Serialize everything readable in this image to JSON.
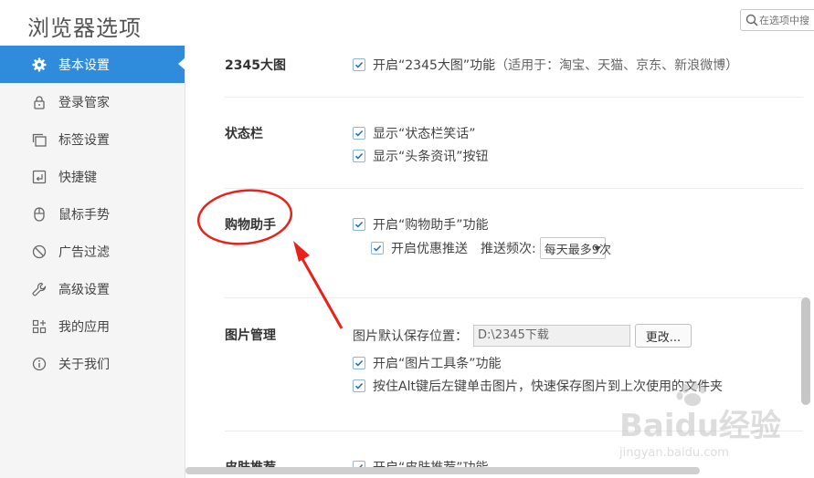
{
  "window": {
    "title": "浏览器选项"
  },
  "search": {
    "placeholder": "在选项中搜"
  },
  "sidebar": {
    "items": [
      {
        "label": "基本设置",
        "icon": "gear-icon",
        "active": true
      },
      {
        "label": "登录管家",
        "icon": "lock-icon"
      },
      {
        "label": "标签设置",
        "icon": "tabs-icon"
      },
      {
        "label": "快捷键",
        "icon": "shortcut-icon"
      },
      {
        "label": "鼠标手势",
        "icon": "mouse-icon"
      },
      {
        "label": "广告过滤",
        "icon": "block-icon"
      },
      {
        "label": "高级设置",
        "icon": "wrench-icon"
      },
      {
        "label": "我的应用",
        "icon": "apps-icon"
      },
      {
        "label": "关于我们",
        "icon": "info-icon"
      }
    ]
  },
  "sections": {
    "s2345": {
      "label": "2345大图",
      "opt1": "开启“2345大图”功能",
      "opt1_note": "（适用于：淘宝、天猫、京东、新浪微博）"
    },
    "statusbar": {
      "label": "状态栏",
      "opt1": "显示“状态栏笑话”",
      "opt2": "显示“头条资讯”按钮"
    },
    "shopping": {
      "label": "购物助手",
      "opt1": "开启“购物助手”功能",
      "opt2": "开启优惠推送",
      "freq_label": "推送频次:",
      "freq_value": "每天最多9次"
    },
    "images": {
      "label": "图片管理",
      "save_label": "图片默认保存位置：",
      "save_path": "D:\\2345下载",
      "change_button": "更改...",
      "opt1": "开启“图片工具条”功能",
      "opt2": "按住Alt键后左键单击图片，快速保存图片到上次使用的文件夹"
    },
    "partial": {
      "label": "皮肤推荐",
      "opt1": "开启“皮肤推荐”功能"
    }
  },
  "watermark": {
    "brand": "Baidu经验",
    "url": "jingyan.baidu.com"
  },
  "colors": {
    "accent": "#2f8cdd",
    "annotation": "#e8221a",
    "check": "#2a6fb8"
  }
}
